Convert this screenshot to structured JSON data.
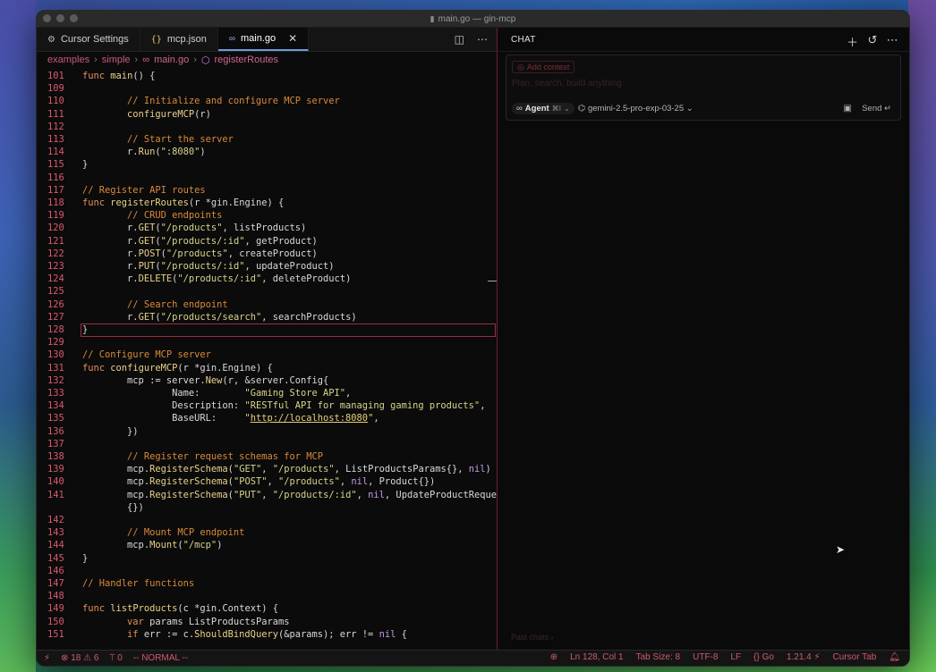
{
  "window": {
    "title": "main.go — gin-mcp"
  },
  "tabs": [
    {
      "label": "Cursor Settings",
      "icon": "gear-icon"
    },
    {
      "label": "mcp.json",
      "icon": "json-icon",
      "glyph": "{}"
    },
    {
      "label": "main.go",
      "icon": "go-icon",
      "active": true
    }
  ],
  "breadcrumb": [
    "examples",
    "simple",
    "main.go",
    "registerRoutes"
  ],
  "code_lines": [
    {
      "n": "101",
      "text": "func main() {"
    },
    {
      "n": "109",
      "text": ""
    },
    {
      "n": "110",
      "text": "        // Initialize and configure MCP server"
    },
    {
      "n": "111",
      "text": "        configureMCP(r)"
    },
    {
      "n": "112",
      "text": ""
    },
    {
      "n": "113",
      "text": "        // Start the server"
    },
    {
      "n": "114",
      "text": "        r.Run(\":8080\")"
    },
    {
      "n": "115",
      "text": "}"
    },
    {
      "n": "116",
      "text": ""
    },
    {
      "n": "117",
      "text": "// Register API routes"
    },
    {
      "n": "118",
      "text": "func registerRoutes(r *gin.Engine) {"
    },
    {
      "n": "119",
      "text": "        // CRUD endpoints"
    },
    {
      "n": "120",
      "text": "        r.GET(\"/products\", listProducts)"
    },
    {
      "n": "121",
      "text": "        r.GET(\"/products/:id\", getProduct)"
    },
    {
      "n": "122",
      "text": "        r.POST(\"/products\", createProduct)"
    },
    {
      "n": "123",
      "text": "        r.PUT(\"/products/:id\", updateProduct)"
    },
    {
      "n": "124",
      "text": "        r.DELETE(\"/products/:id\", deleteProduct)"
    },
    {
      "n": "125",
      "text": ""
    },
    {
      "n": "126",
      "text": "        // Search endpoint"
    },
    {
      "n": "127",
      "text": "        r.GET(\"/products/search\", searchProducts)"
    },
    {
      "n": "128",
      "text": "}"
    },
    {
      "n": "129",
      "text": ""
    },
    {
      "n": "130",
      "text": "// Configure MCP server"
    },
    {
      "n": "131",
      "text": "func configureMCP(r *gin.Engine) {"
    },
    {
      "n": "132",
      "text": "        mcp := server.New(r, &server.Config{"
    },
    {
      "n": "133",
      "text": "                Name:        \"Gaming Store API\","
    },
    {
      "n": "134",
      "text": "                Description: \"RESTful API for managing gaming products\","
    },
    {
      "n": "135",
      "text": "                BaseURL:     \"http://localhost:8080\","
    },
    {
      "n": "136",
      "text": "        })"
    },
    {
      "n": "137",
      "text": ""
    },
    {
      "n": "138",
      "text": "        // Register request schemas for MCP"
    },
    {
      "n": "139",
      "text": "        mcp.RegisterSchema(\"GET\", \"/products\", ListProductsParams{}, nil)"
    },
    {
      "n": "140",
      "text": "        mcp.RegisterSchema(\"POST\", \"/products\", nil, Product{})"
    },
    {
      "n": "141",
      "text": "        mcp.RegisterSchema(\"PUT\", \"/products/:id\", nil, UpdateProductRequest"
    },
    {
      "n": "",
      "text": "        {})"
    },
    {
      "n": "142",
      "text": ""
    },
    {
      "n": "143",
      "text": "        // Mount MCP endpoint"
    },
    {
      "n": "144",
      "text": "        mcp.Mount(\"/mcp\")"
    },
    {
      "n": "145",
      "text": "}"
    },
    {
      "n": "146",
      "text": ""
    },
    {
      "n": "147",
      "text": "// Handler functions"
    },
    {
      "n": "148",
      "text": ""
    },
    {
      "n": "149",
      "text": "func listProducts(c *gin.Context) {"
    },
    {
      "n": "150",
      "text": "        var params ListProductsParams"
    },
    {
      "n": "151",
      "text": "        if err := c.ShouldBindQuery(&params); err != nil {"
    }
  ],
  "highlighted_line": "128",
  "chat": {
    "title": "CHAT",
    "add_context": "Add context",
    "placeholder": "Plan, search, build anything",
    "agent_label": "Agent",
    "agent_shortcut": "⌘I",
    "model": "gemini-2.5-pro-exp-03-25",
    "send": "Send",
    "past_chats": "Past chats"
  },
  "status": {
    "errors": "18",
    "warnings": "6",
    "ports": "0",
    "mode": "-- NORMAL --",
    "position": "Ln 128, Col 1",
    "tab_size": "Tab Size: 8",
    "encoding": "UTF-8",
    "eol": "LF",
    "language": "Go",
    "go_version": "1.21.4",
    "cursor_tab": "Cursor Tab"
  },
  "colors": {
    "accent": "#6d9be0",
    "line_number": "#d95a6e",
    "comment": "#d98a3a",
    "string": "#d7d48b"
  }
}
